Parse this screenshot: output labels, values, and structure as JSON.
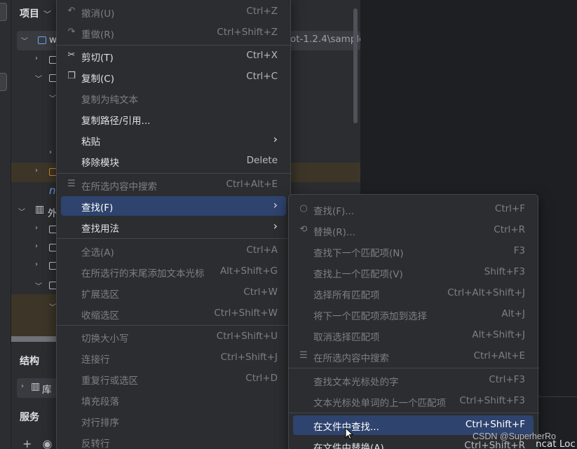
{
  "project_panel": {
    "title": "项目",
    "root_fragment": "w",
    "path_fragment": "ot-1.2.4\\sample",
    "orange_item_fragment": "n",
    "external_fragment": "外",
    "structure_title": "结构",
    "structure_item_fragment": "库",
    "services_title": "服务"
  },
  "context_menu": {
    "items": [
      {
        "label": "撤消(U)",
        "shortcut": "Ctrl+Z",
        "disabled": true,
        "icon": "undo-icon"
      },
      {
        "label": "重做(R)",
        "shortcut": "Ctrl+Shift+Z",
        "disabled": true,
        "icon": "redo-icon"
      },
      {
        "label": "剪切(T)",
        "shortcut": "Ctrl+X",
        "disabled": false,
        "icon": "scissors-icon"
      },
      {
        "label": "复制(C)",
        "shortcut": "Ctrl+C",
        "disabled": false,
        "icon": "copy-icon"
      },
      {
        "label": "复制为纯文本",
        "shortcut": "",
        "disabled": true
      },
      {
        "label": "复制路径/引用...",
        "shortcut": "",
        "disabled": false
      },
      {
        "label": "粘贴",
        "shortcut": "",
        "disabled": false,
        "submenu": true
      },
      {
        "label": "移除模块",
        "shortcut": "Delete",
        "disabled": false
      },
      {
        "label": "在所选内容中搜索",
        "shortcut": "Ctrl+Alt+E",
        "disabled": true,
        "icon": "search-in-selection-icon"
      },
      {
        "label": "查找(F)",
        "shortcut": "",
        "disabled": false,
        "submenu": true,
        "selected": true
      },
      {
        "label": "查找用法",
        "shortcut": "",
        "disabled": false,
        "submenu": true
      },
      {
        "label": "全选(A)",
        "shortcut": "Ctrl+A",
        "disabled": true
      },
      {
        "label": "在所选行的末尾添加文本光标",
        "shortcut": "Alt+Shift+G",
        "disabled": true
      },
      {
        "label": "扩展选区",
        "shortcut": "Ctrl+W",
        "disabled": true
      },
      {
        "label": "收缩选区",
        "shortcut": "Ctrl+Shift+W",
        "disabled": true
      },
      {
        "label": "切换大小写",
        "shortcut": "Ctrl+Shift+U",
        "disabled": true
      },
      {
        "label": "连接行",
        "shortcut": "Ctrl+Shift+J",
        "disabled": true
      },
      {
        "label": "重复行或选区",
        "shortcut": "Ctrl+D",
        "disabled": true
      },
      {
        "label": "填充段落",
        "shortcut": "",
        "disabled": true
      },
      {
        "label": "对行排序",
        "shortcut": "",
        "disabled": true
      },
      {
        "label": "反转行",
        "shortcut": "",
        "disabled": true
      }
    ]
  },
  "find_submenu": {
    "items": [
      {
        "label": "查找(F)...",
        "shortcut": "Ctrl+F",
        "disabled": true,
        "icon": "search-icon"
      },
      {
        "label": "替换(R)...",
        "shortcut": "Ctrl+R",
        "disabled": true,
        "icon": "replace-icon"
      },
      {
        "label": "查找下一个匹配项(N)",
        "shortcut": "F3",
        "disabled": true
      },
      {
        "label": "查找上一个匹配项(V)",
        "shortcut": "Shift+F3",
        "disabled": true
      },
      {
        "label": "选择所有匹配项",
        "shortcut": "Ctrl+Alt+Shift+J",
        "disabled": true
      },
      {
        "label": "将下一个匹配项添加到选择",
        "shortcut": "Alt+J",
        "disabled": true
      },
      {
        "label": "取消选择匹配项",
        "shortcut": "Alt+Shift+J",
        "disabled": true
      },
      {
        "label": "在所选内容中搜索",
        "shortcut": "Ctrl+Alt+E",
        "disabled": true,
        "icon": "search-in-selection-icon"
      },
      {
        "label": "查找文本光标处的字",
        "shortcut": "Ctrl+F3",
        "disabled": true
      },
      {
        "label": "文本光标处单词的上一个匹配项",
        "shortcut": "Ctrl+Shift+F3",
        "disabled": true
      },
      {
        "label": "在文件中查找...",
        "shortcut": "Ctrl+Shift+F",
        "disabled": false,
        "selected": true
      },
      {
        "label": "在文件中替换(A)...",
        "shortcut": "Ctrl+Shift+R",
        "disabled": false
      }
    ]
  },
  "watermark": "CSDN @SuperherRo",
  "tomcat_fragment": "ncat Loc",
  "colors": {
    "background": "#2b2d30",
    "menu_background": "#2b2d30",
    "selection": "#2e436e",
    "disabled_text": "#7c7f86",
    "highlight_row": "#3d3628"
  }
}
